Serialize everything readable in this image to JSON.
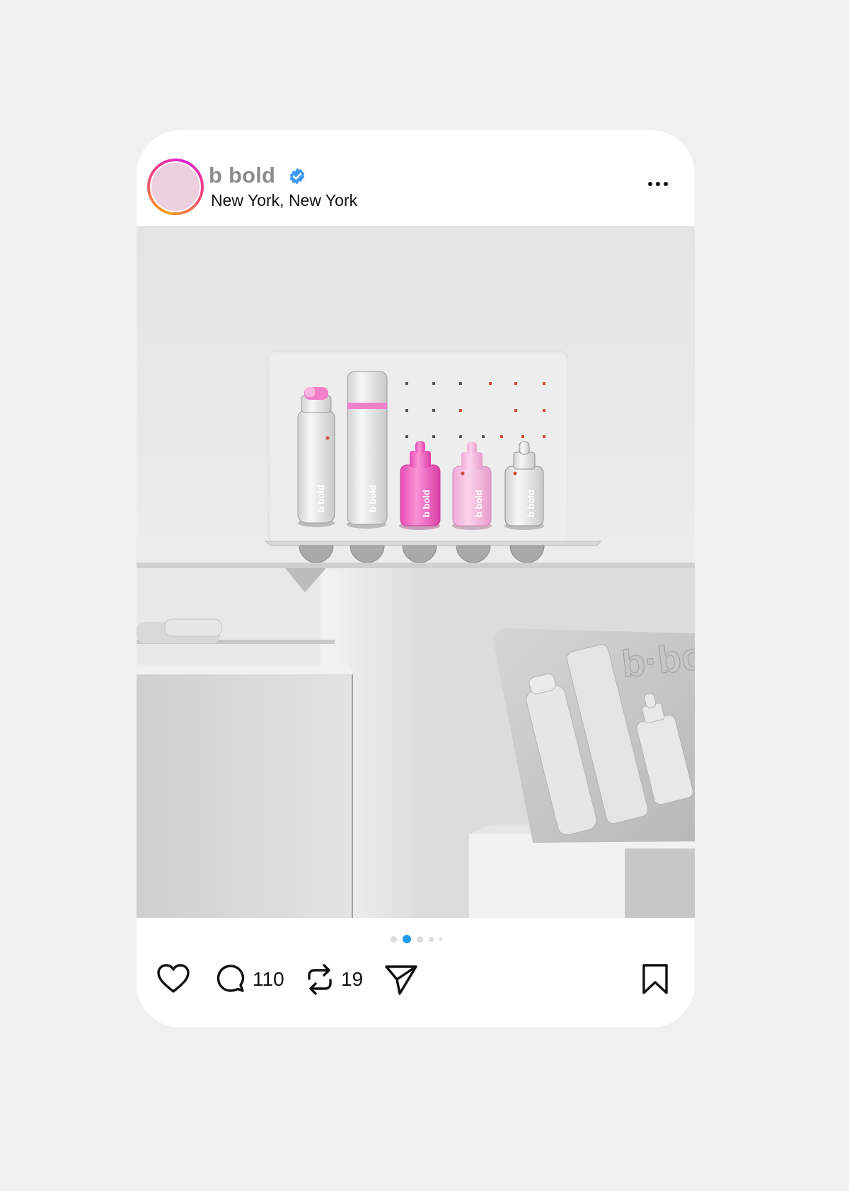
{
  "post": {
    "username": "b bold",
    "location": "New York, New York",
    "verified": true,
    "avatar_color": "#ecd0de",
    "comments_count": "110",
    "reposts_count": "19",
    "carousel": {
      "total": 5,
      "active": 2
    },
    "photo": {
      "brand_text": "b·bold",
      "product_label": "b bold"
    }
  },
  "icons": {
    "like": "heart-icon",
    "comment": "comment-icon",
    "repost": "repost-icon",
    "share": "send-icon",
    "save": "bookmark-icon",
    "more": "more-icon",
    "verified": "verified-badge-icon"
  },
  "colors": {
    "accent": "#1d9bf0",
    "pink": "#f06bc6",
    "light_pink": "#f5b8dd"
  }
}
